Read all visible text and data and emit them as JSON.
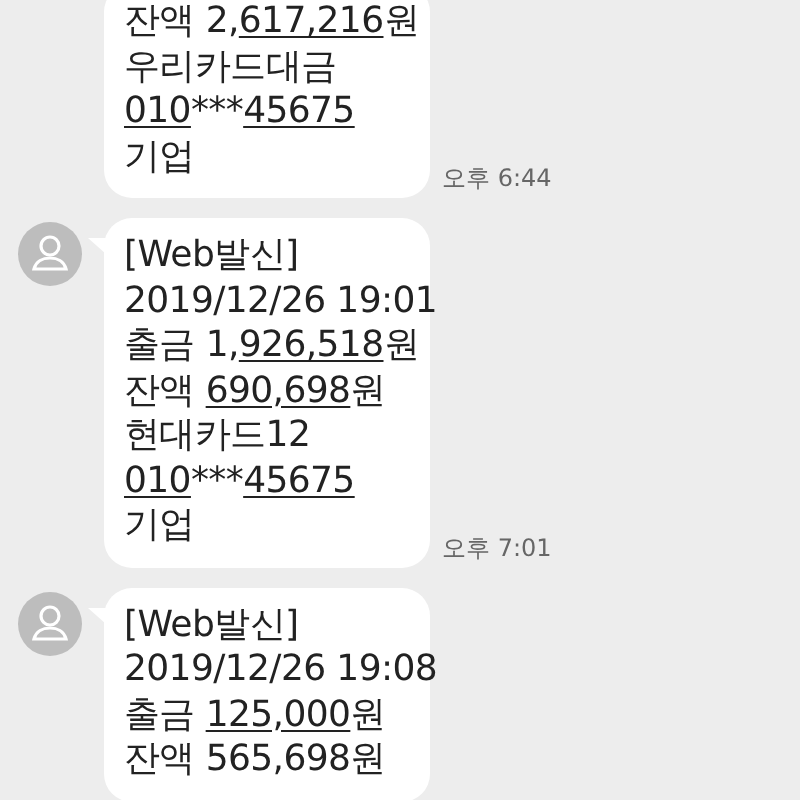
{
  "messages": [
    {
      "avatar": false,
      "lines": [
        [
          {
            "text": "잔액 2,",
            "link": false
          },
          {
            "text": "617,216",
            "link": true
          },
          {
            "text": "원",
            "link": false
          }
        ],
        [
          {
            "text": "우리카드대금",
            "link": false
          }
        ],
        [
          {
            "text": "010",
            "link": true
          },
          {
            "text": "***",
            "link": false
          },
          {
            "text": "45675",
            "link": true
          }
        ],
        [
          {
            "text": "기업",
            "link": false
          }
        ]
      ],
      "time": "오후 6:44"
    },
    {
      "avatar": true,
      "lines": [
        [
          {
            "text": "[Web발신]",
            "link": false
          }
        ],
        [
          {
            "text": "2019/12/26 19:01",
            "link": false
          }
        ],
        [
          {
            "text": "출금 1,",
            "link": false
          },
          {
            "text": "926,518",
            "link": true
          },
          {
            "text": "원",
            "link": false
          }
        ],
        [
          {
            "text": "잔액 ",
            "link": false
          },
          {
            "text": "690,698",
            "link": true
          },
          {
            "text": "원",
            "link": false
          }
        ],
        [
          {
            "text": "현대카드12",
            "link": false
          }
        ],
        [
          {
            "text": "010",
            "link": true
          },
          {
            "text": "***",
            "link": false
          },
          {
            "text": "45675",
            "link": true
          }
        ],
        [
          {
            "text": "기업",
            "link": false
          }
        ]
      ],
      "time": "오후 7:01"
    },
    {
      "avatar": true,
      "lines": [
        [
          {
            "text": "[Web발신]",
            "link": false
          }
        ],
        [
          {
            "text": "2019/12/26 19:08",
            "link": false
          }
        ],
        [
          {
            "text": "출금 ",
            "link": false
          },
          {
            "text": "125,000",
            "link": true
          },
          {
            "text": "원",
            "link": false
          }
        ],
        [
          {
            "text": "잔액 565,698원",
            "link": false
          }
        ]
      ]
    }
  ]
}
